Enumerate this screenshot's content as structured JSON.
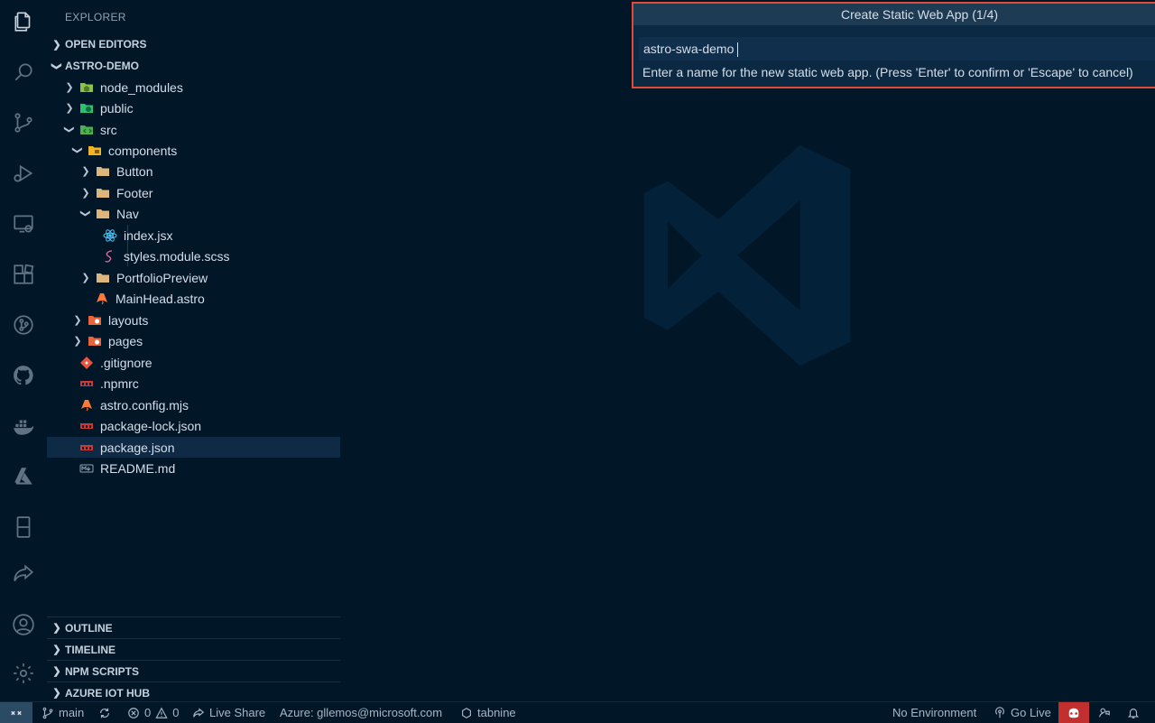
{
  "sidebar": {
    "title": "EXPLORER",
    "open_editors": "OPEN EDITORS",
    "workspace": "ASTRO-DEMO",
    "tree": [
      {
        "label": "node_modules",
        "kind": "folder-node",
        "expanded": false
      },
      {
        "label": "public",
        "kind": "folder-public",
        "expanded": false
      },
      {
        "label": "src",
        "kind": "folder-src",
        "expanded": true
      },
      {
        "label": "components",
        "kind": "folder-components",
        "expanded": true
      },
      {
        "label": "Button",
        "kind": "folder",
        "expanded": false
      },
      {
        "label": "Footer",
        "kind": "folder",
        "expanded": false
      },
      {
        "label": "Nav",
        "kind": "folder",
        "expanded": true
      },
      {
        "label": "index.jsx",
        "kind": "react-file"
      },
      {
        "label": "styles.module.scss",
        "kind": "scss-file"
      },
      {
        "label": "PortfolioPreview",
        "kind": "folder",
        "expanded": false
      },
      {
        "label": "MainHead.astro",
        "kind": "astro-file"
      },
      {
        "label": "layouts",
        "kind": "folder-layouts",
        "expanded": false
      },
      {
        "label": "pages",
        "kind": "folder-pages",
        "expanded": false
      },
      {
        "label": ".gitignore",
        "kind": "git-file"
      },
      {
        "label": ".npmrc",
        "kind": "npm-file"
      },
      {
        "label": "astro.config.mjs",
        "kind": "astro-file"
      },
      {
        "label": "package-lock.json",
        "kind": "npm-file"
      },
      {
        "label": "package.json",
        "kind": "npm-file"
      },
      {
        "label": "README.md",
        "kind": "markdown-file"
      }
    ],
    "bottom_sections": [
      "OUTLINE",
      "TIMELINE",
      "NPM SCRIPTS",
      "AZURE IOT HUB"
    ]
  },
  "quick_input": {
    "title": "Create Static Web App (1/4)",
    "value": "astro-swa-demo",
    "message": "Enter a name for the new static web app. (Press 'Enter' to confirm or 'Escape' to cancel)"
  },
  "status_bar": {
    "branch": "main",
    "errors": "0",
    "warnings": "0",
    "live_share": "Live Share",
    "azure_account": "Azure: gllemos@microsoft.com",
    "tabnine": "tabnine",
    "environment": "No Environment",
    "go_live": "Go Live"
  },
  "colors": {
    "background": "#011627",
    "accent_border": "#e04b37",
    "folder": "#dcb67a",
    "copilot": "#c12f2f"
  }
}
